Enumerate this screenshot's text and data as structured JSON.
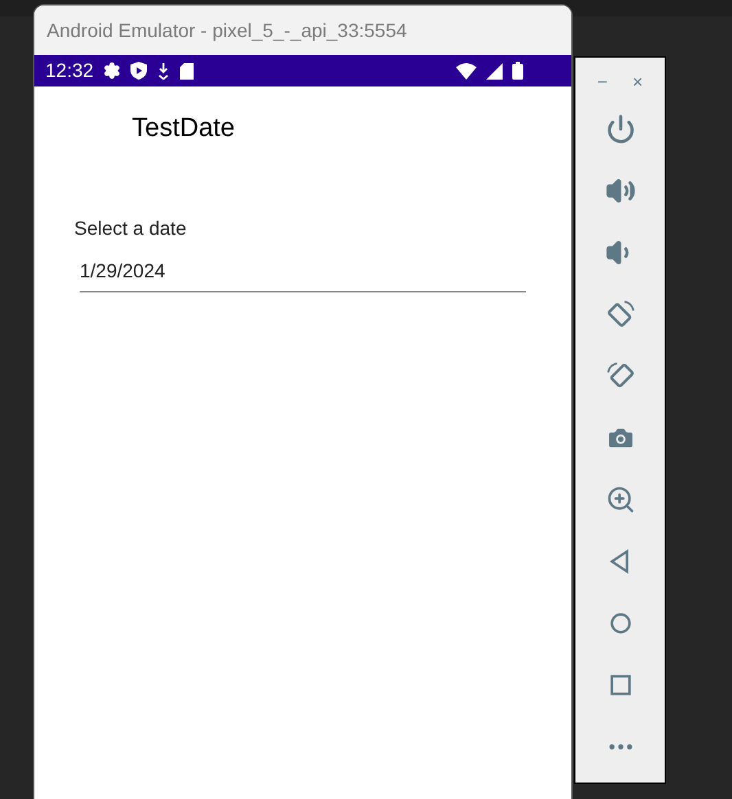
{
  "window": {
    "title": "Android Emulator - pixel_5_-_api_33:5554"
  },
  "status_bar": {
    "time": "12:32"
  },
  "app": {
    "title": "TestDate",
    "date_field": {
      "label": "Select a date",
      "value": "1/29/2024"
    }
  },
  "toolbar": {
    "window_controls": [
      "−",
      "×"
    ]
  }
}
